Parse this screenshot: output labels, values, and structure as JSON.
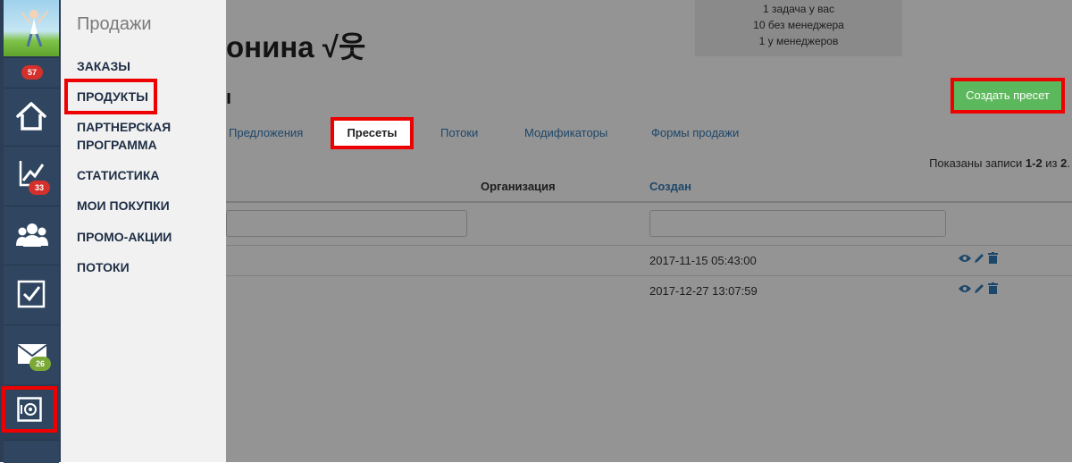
{
  "rail": {
    "badges": {
      "top": "57",
      "stats": "33",
      "mail": "26"
    },
    "icons": [
      "home-icon",
      "chart-icon",
      "users-icon",
      "checkbox-icon",
      "mail-icon",
      "safe-icon"
    ]
  },
  "flyout": {
    "title": "Продажи",
    "items": [
      {
        "label": "ЗАКАЗЫ"
      },
      {
        "label": "ПРОДУКТЫ"
      },
      {
        "label": "ПАРТНЕРСКАЯ"
      },
      {
        "label": "ПРОГРАММА"
      },
      {
        "label": "СТАТИСТИКА"
      },
      {
        "label": "МОИ ПОКУПКИ"
      },
      {
        "label": "ПРОМО-АКЦИИ"
      },
      {
        "label": "ПОТОКИ"
      }
    ]
  },
  "header": {
    "title": "онина √웃",
    "subtitle": "ı",
    "info": [
      "1 задача у вас",
      "10 без менеджера",
      "1 у менеджеров"
    ]
  },
  "toolbar": {
    "create_label": "Создать пресет"
  },
  "tabs": [
    {
      "label": "Предложения"
    },
    {
      "label": "Пресеты",
      "active": true
    },
    {
      "label": "Потоки"
    },
    {
      "label": "Модификаторы"
    },
    {
      "label": "Формы продажи"
    }
  ],
  "table": {
    "summary_prefix": "Показаны записи ",
    "summary_range": "1-2",
    "summary_mid": " из ",
    "summary_total": "2",
    "summary_suffix": ".",
    "columns": {
      "org": "Организация",
      "created": "Создан"
    },
    "rows": [
      {
        "created": "2017-11-15 05:43:00"
      },
      {
        "created": "2017-12-27 13:07:59"
      }
    ]
  },
  "colors": {
    "accent": "#337ab7",
    "success": "#5cb85c",
    "highlight": "#e00000",
    "rail": "#2c3e55"
  }
}
